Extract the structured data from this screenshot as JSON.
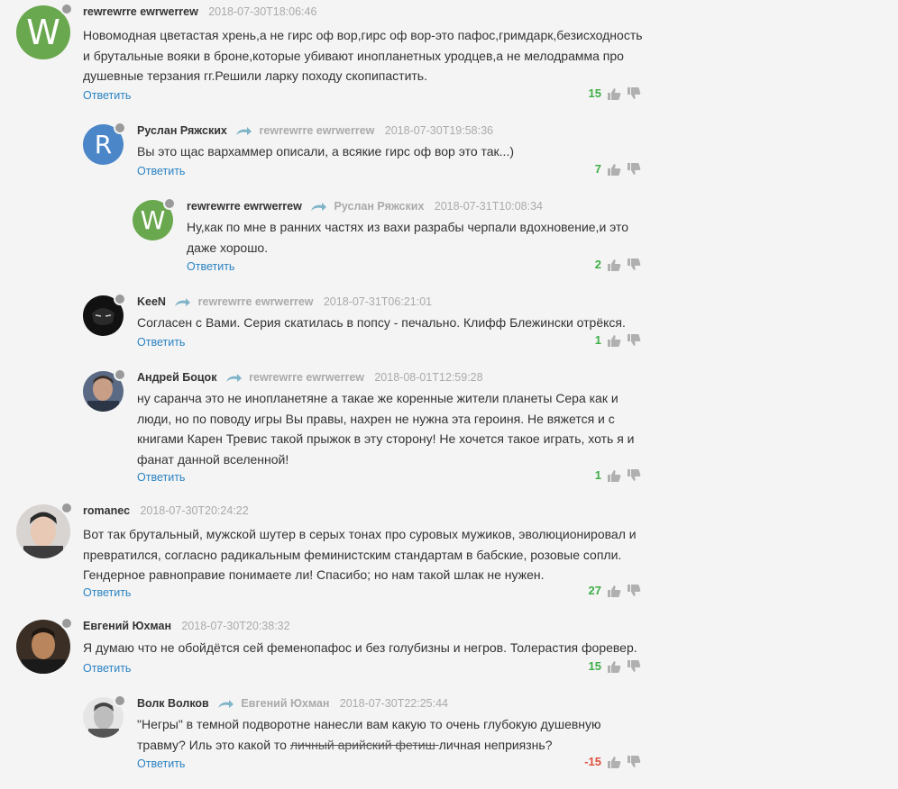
{
  "common": {
    "reply_label": "Ответить"
  },
  "comments": [
    {
      "author": "rewrewrre ewrwerrew",
      "reply_to": "",
      "date": "2018-07-30T18:06:46",
      "lines": [
        "Новомодная цветастая хрень,а не гирс оф вор,гирс оф вор-это пафос,гримдарк,безисходность",
        "и брутальные вояки в броне,которые убивают инопланетных уродцев,а не мелодрамма про",
        "душевные терзания гг.Решили ларку походу скопипастить."
      ],
      "score": "15",
      "avatar_letter": "W",
      "avatar_color": "#6aa84f"
    },
    {
      "author": "Руслан Ряжских",
      "reply_to": "rewrewrre ewrwerrew",
      "date": "2018-07-30T19:58:36",
      "lines": [
        "Вы это щас вархаммер описали, а всякие гирс оф вор это так...)"
      ],
      "score": "7",
      "avatar_letter": "R",
      "avatar_color": "#4a86c8"
    },
    {
      "author": "rewrewrre ewrwerrew",
      "reply_to": "Руслан Ряжских",
      "date": "2018-07-31T10:08:34",
      "lines": [
        "Ну,как по мне в ранних частях из вахи разрабы черпали вдохновение,и это",
        "даже хорошо."
      ],
      "score": "2",
      "avatar_letter": "W",
      "avatar_color": "#6aa84f"
    },
    {
      "author": "KeeN",
      "reply_to": "rewrewrre ewrwerrew",
      "date": "2018-07-31T06:21:01",
      "lines": [
        "Согласен с Вами. Серия скатилась в попсу - печально. Клифф Блежински отрёкся."
      ],
      "score": "1"
    },
    {
      "author": "Андрей Боцок",
      "reply_to": "rewrewrre ewrwerrew",
      "date": "2018-08-01T12:59:28",
      "lines": [
        "ну саранча это не инопланетяне а такае же коренные жители планеты Сера как и",
        "люди, но по поводу игры Вы правы, нахрен не нужна эта героиня. Не вяжется и с",
        "книгами Карен Тревис такой прыжок в эту сторону! Не хочется такое играть, хоть я и",
        "фанат данной вселенной!"
      ],
      "score": "1"
    },
    {
      "author": "romanec",
      "reply_to": "",
      "date": "2018-07-30T20:24:22",
      "lines": [
        "Вот так брутальный, мужской шутер в серых тонах про суровых мужиков, эволюционировал и",
        "превратился, согласно радикальным феминистским стандартам в бабские, розовые сопли.",
        "Гендерное равноправие понимаете ли! Спасибо; но нам такой шлак не нужен."
      ],
      "score": "27"
    },
    {
      "author": "Евгений Юхман",
      "reply_to": "",
      "date": "2018-07-30T20:38:32",
      "lines": [
        "Я думаю что не обойдётся сей феменопафос и без голубизны и негров. Толерастия форевер."
      ],
      "score": "15"
    },
    {
      "author": "Волк Волков",
      "reply_to": "Евгений Юхман",
      "date": "2018-07-30T22:25:44",
      "line1": "\"Негры\" в темной подворотне нанесли вам какую то очень глубокую душевную",
      "line2_before": "травму? Иль это какой то ",
      "line2_struck": "личный арийский фетиш ",
      "line2_after": "личная неприязнь?",
      "score": "-15"
    }
  ]
}
